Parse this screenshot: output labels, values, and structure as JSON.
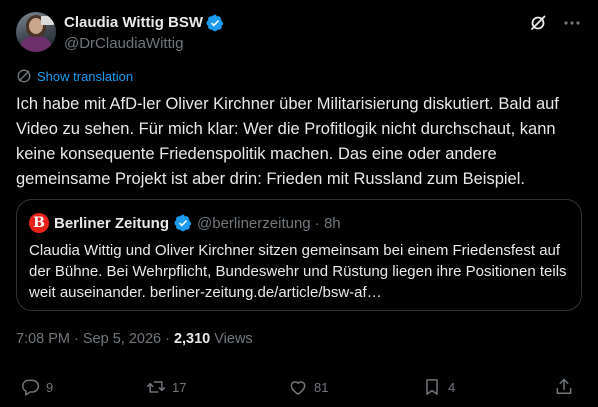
{
  "author": {
    "display_name": "Claudia Wittig BSW",
    "handle": "@DrClaudiaWittig"
  },
  "translate_label": "Show translation",
  "tweet_text": "Ich habe mit AfD-ler Oliver Kirchner über Militarisierung diskutiert. Bald auf Video zu sehen. Für mich klar: Wer die Profitlogik nicht durchschaut, kann keine konsequente Friedenspolitik machen. Das eine oder andere gemeinsame Projekt ist aber drin: Frieden mit Russland zum Beispiel.",
  "quote": {
    "logo_letter": "B",
    "name": "Berliner Zeitung",
    "handle_time": "@berlinerzeitung · 8h",
    "text": "Claudia Wittig und Oliver Kirchner sitzen gemeinsam bei einem Friedensfest auf der Bühne. Bei Wehrpflicht, Bundeswehr und Rüstung liegen ihre Positionen teils weit auseinander. berliner-zeitung.de/article/bsw-af…"
  },
  "meta": {
    "time_date": "7:08 PM · Sep 5, 2026 ·",
    "views_count": "2,310",
    "views_label": "Views"
  },
  "actions": {
    "replies": "9",
    "reposts": "17",
    "likes": "81",
    "bookmarks": "4"
  },
  "colors": {
    "background": "#000000",
    "text": "#e7e9ea",
    "muted": "#71767b",
    "accent": "#1d9bf0",
    "border": "#2f3336"
  },
  "icons": [
    "verified-badge-icon",
    "grok-icon",
    "more-icon",
    "translate-icon",
    "reply-icon",
    "repost-icon",
    "like-icon",
    "bookmark-icon",
    "share-icon"
  ]
}
